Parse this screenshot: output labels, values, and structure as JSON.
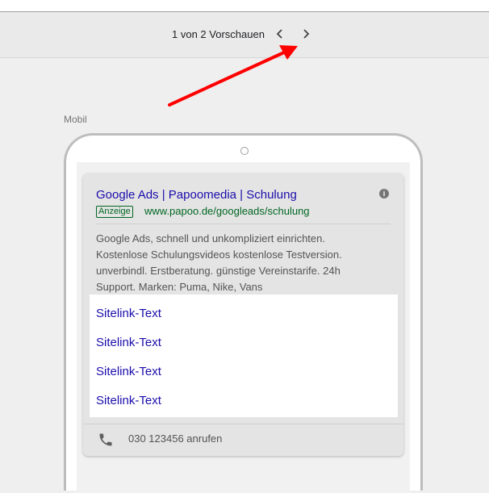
{
  "pager": {
    "text": "1 von 2 Vorschauen",
    "prev_icon": "chevron-left-icon",
    "next_icon": "chevron-right-icon"
  },
  "annotation": {
    "arrow_color": "#ff0000"
  },
  "preview": {
    "device_label": "Mobil",
    "ad": {
      "title": "Google Ads | Papoomedia | Schulung",
      "badge": "Anzeige",
      "display_url": "www.papoo.de/googleads/schulung",
      "description_lines": [
        "Google Ads, schnell und unkompliziert einrichten.",
        "Kostenlose Schulungsvideos kostenlose Testversion.",
        "unverbindl. Erstberatung. günstige Vereinstarife. 24h",
        "Support. Marken: Puma, Nike, Vans"
      ],
      "sitelinks": [
        "Sitelink-Text",
        "Sitelink-Text",
        "Sitelink-Text",
        "Sitelink-Text"
      ],
      "call": {
        "icon": "phone-icon",
        "text": "030 123456 anrufen"
      }
    }
  },
  "colors": {
    "link": "#1a0dab",
    "url": "#006621",
    "text": "#545454"
  }
}
